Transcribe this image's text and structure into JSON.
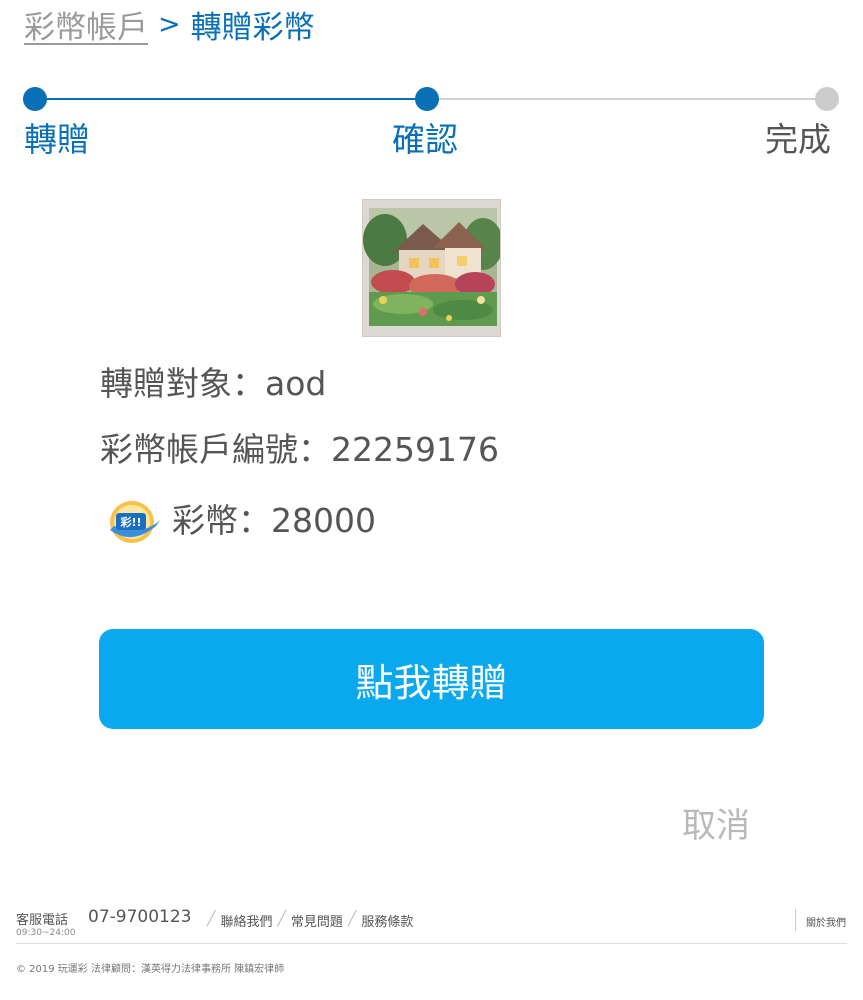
{
  "breadcrumb": {
    "parent": "彩幣帳戶",
    "separator": ">",
    "current": "轉贈彩幣"
  },
  "steps": [
    {
      "label": "轉贈",
      "state": "done"
    },
    {
      "label": "確認",
      "state": "current"
    },
    {
      "label": "完成",
      "state": "pending"
    }
  ],
  "colors": {
    "primary": "#0a70b5",
    "button": "#0aa8ee",
    "inactive": "#cccccc"
  },
  "thumbnail": {
    "icon": "cottage-painting-image"
  },
  "info": {
    "recipient_label": "轉贈對象：",
    "recipient_value": "aod",
    "account_label": "彩幣帳戶編號：",
    "account_value": "22259176",
    "coins_label": "彩幣：",
    "coins_value": "28000",
    "coin_icon_text": "彩!!"
  },
  "actions": {
    "confirm": "點我轉贈",
    "cancel": "取消"
  },
  "footer": {
    "service_label": "客服電話",
    "service_hours": "09:30~24:00",
    "service_phone": "07-9700123",
    "links": [
      "聯絡我們",
      "常見問題",
      "服務條款"
    ],
    "about": "關於我們",
    "copyright": "© 2019 玩運彩 法律顧問：漢英得力法律事務所 陳鎮宏律師"
  }
}
